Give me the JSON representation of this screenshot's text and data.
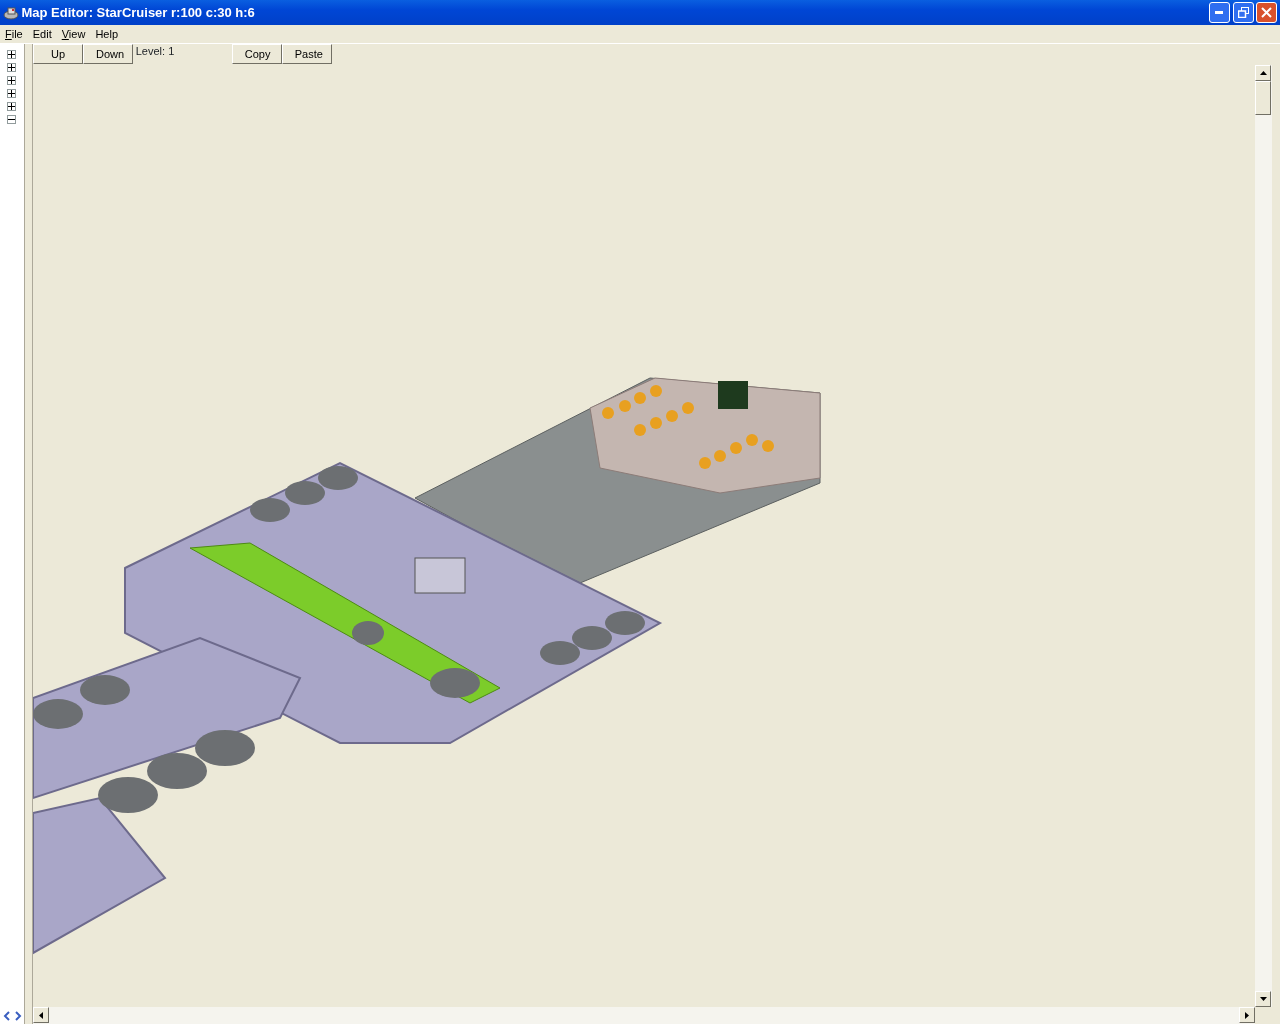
{
  "window": {
    "title": "Map Editor: StarCruiser r:100 c:30 h:6"
  },
  "menu": [
    {
      "label": "File",
      "underline_first": true
    },
    {
      "label": "Edit",
      "underline_first": false
    },
    {
      "label": "View",
      "underline_first": true
    },
    {
      "label": "Help",
      "underline_first": false
    }
  ],
  "tree_nodes": [
    {
      "expanded": false
    },
    {
      "expanded": false
    },
    {
      "expanded": false
    },
    {
      "expanded": false
    },
    {
      "expanded": false
    },
    {
      "expanded": true
    }
  ],
  "toolbar": {
    "level_buttons": [
      "Up",
      "Down"
    ],
    "level_label": "Level: 1",
    "clipboard_buttons": [
      "Copy",
      "Paste"
    ]
  }
}
